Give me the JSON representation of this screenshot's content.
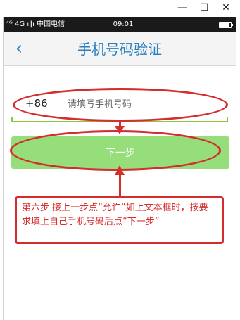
{
  "window": {
    "controls": {
      "minimize": "—",
      "maximize": "☐",
      "close": "✕"
    }
  },
  "status_bar": {
    "carrier": "⁴ᴳ 4G ı‖ı 中国电信",
    "time": "09:01",
    "battery_level": 0.85
  },
  "header": {
    "back_icon": "‹",
    "title": "手机号码验证"
  },
  "phone_field": {
    "prefix": "+86",
    "placeholder": "请填写手机号码",
    "value": ""
  },
  "next_button": {
    "label": "下一步"
  },
  "annotation": {
    "text": "第六步 接上一步点“允许”如上文本框时，按要求填上自己手机号码后点“下一步”",
    "color": "#d42d2d"
  },
  "colors": {
    "accent": "#2a7fbf",
    "button": "#95de7a",
    "underline": "#8ec63f"
  }
}
